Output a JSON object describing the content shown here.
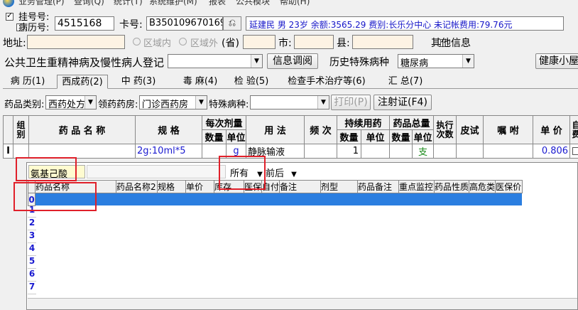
{
  "menu": [
    "业务管理(P)",
    "查询(Q)",
    "统计(T)",
    "系统维护(M)",
    "报表",
    "公共模块",
    "帮助(H)"
  ],
  "patient": {
    "reg_label": "挂号号:",
    "case_label": "病历号:",
    "reg_value": "4515168",
    "card_label": "卡号:",
    "card_value": "B350109670169",
    "info_text": "延建民 男 23岁 余额:3565.29 费别:长乐分中心 未记帐费用:79.76元"
  },
  "address": {
    "addr_label": "地址:",
    "inside_label": "区域内",
    "outside_label": "区域外",
    "province_label": "(省)",
    "city_label": "市:",
    "county_label": "县:",
    "other_info_label": "其他信息"
  },
  "row3": {
    "register_label": "公共卫生重精神病及慢性病人登记",
    "query_button": "信息调阅",
    "history_label": "历史特殊病种",
    "disease_value": "糖尿病",
    "health_button": "健康小屋"
  },
  "tabs": [
    "病 历(1)",
    "西成药(2)",
    "中 药(3)",
    "毒 麻(4)",
    "检 验(5)",
    "检查手术治疗等(6)",
    "汇 总(7)"
  ],
  "active_tab": 1,
  "toolbar": {
    "category_label": "药品类别:",
    "category_value": "西药处方",
    "pharmacy_label": "领药药房:",
    "pharmacy_value": "门诊西药房",
    "disease_label": "特殊病种:",
    "disease_value": "",
    "print_button": "打印(P)",
    "injection_button": "注射证(F4)"
  },
  "grid": {
    "headers": {
      "group": "组别",
      "name": "药 品 名 称",
      "spec": "规 格",
      "per_dose": "每次剂量",
      "qty": "数量",
      "unit": "单位",
      "usage": "用 法",
      "freq": "频 次",
      "duration": "持续用药",
      "total": "药品总量",
      "exec": "执行次数",
      "skin": "皮试",
      "advice": "嘱 咐",
      "price": "单 价",
      "self": "自费"
    },
    "row": {
      "group": "I",
      "spec": "2g:10ml*5",
      "unit": "g",
      "usage": "静脉输液",
      "duration_qty": "1",
      "total_unit": "支",
      "price": "0.806"
    }
  },
  "popup": {
    "search_value": "氨基己酸",
    "filter_value": "所有",
    "position_value": "前后",
    "columns": [
      "药品名称",
      "药品名称2",
      "规格",
      "单价",
      "库存",
      "医保",
      "自付",
      "备注",
      "剂型",
      "药品备注",
      "重点监控",
      "药品性质",
      "高危类",
      "医保价"
    ],
    "rows": [
      "0",
      "1",
      "2",
      "3",
      "4",
      "5",
      "6",
      "7"
    ]
  }
}
